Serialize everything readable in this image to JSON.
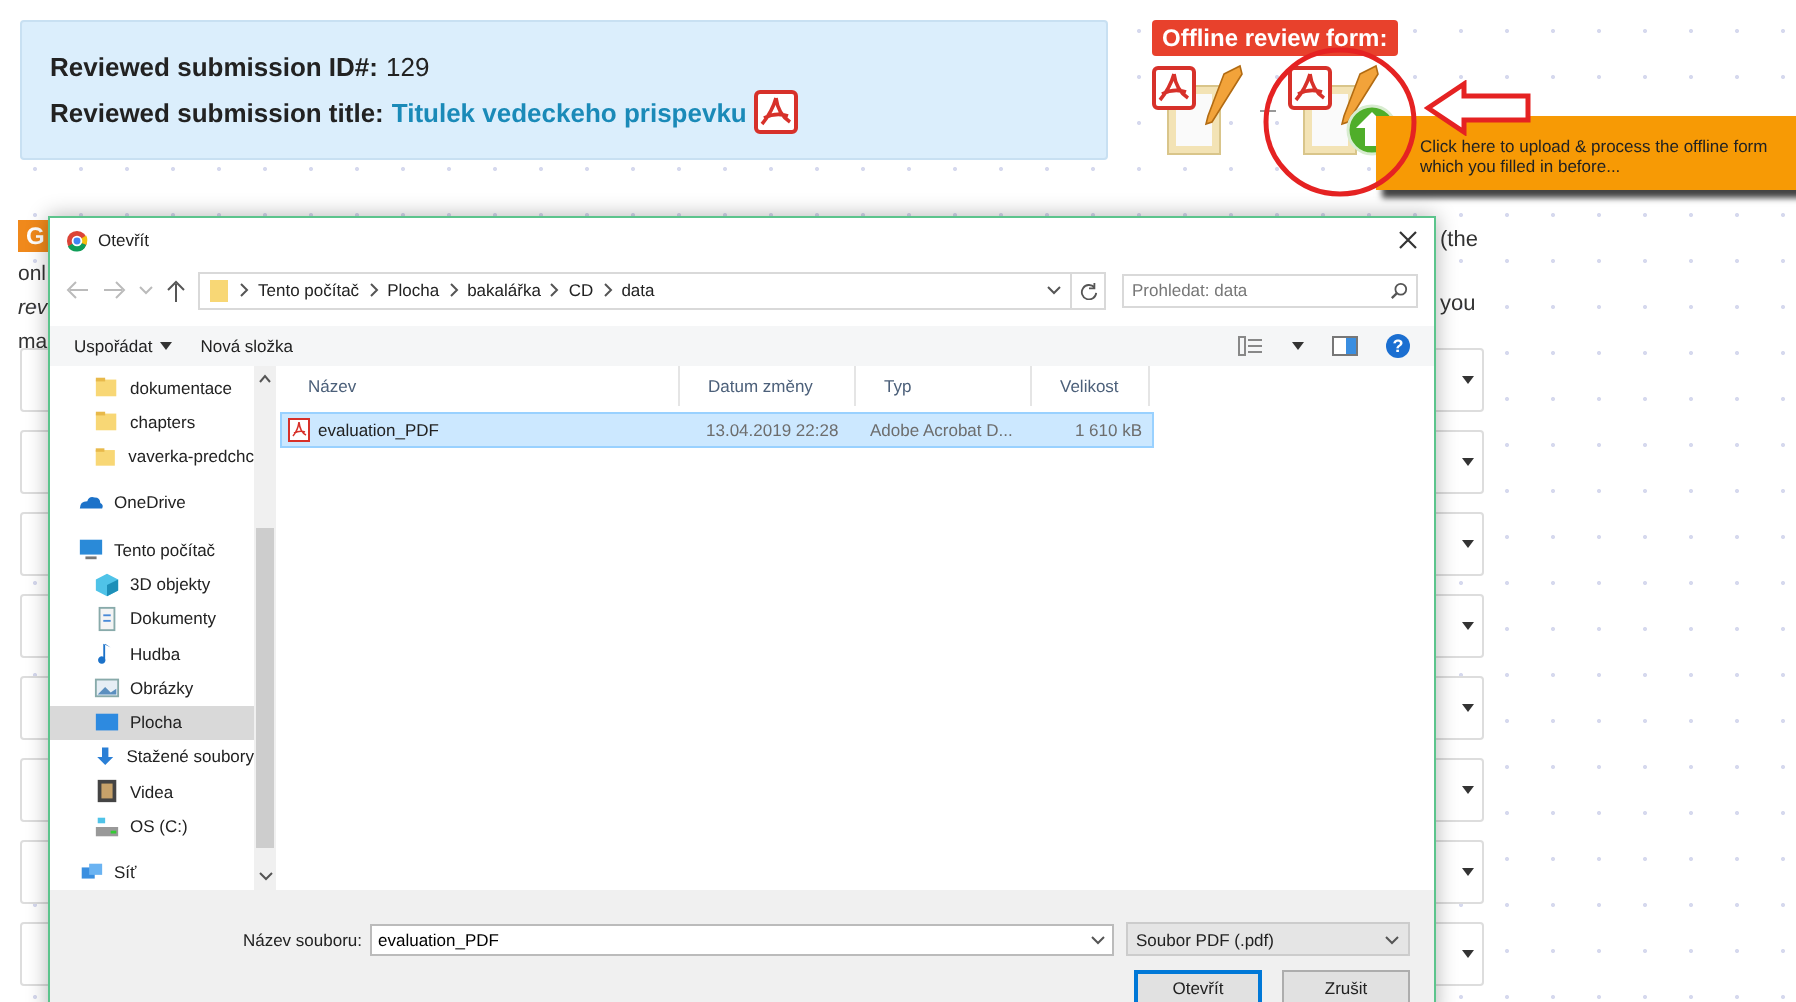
{
  "submission": {
    "id_label": "Reviewed submission ID#:",
    "id_value": "129",
    "title_label": "Reviewed submission title:",
    "title_link": "Titulek vedeckeho prispevku"
  },
  "offline_form": {
    "label": "Offline review form:",
    "tooltip": "Click here to upload & process the offline form which you filled in before..."
  },
  "page_text": {
    "badge": "G",
    "left_lines": [
      "onl",
      "rev",
      "ma"
    ],
    "right_lines": [
      "(the",
      "you"
    ]
  },
  "form_selects": [
    {
      "kind": "dropdown"
    },
    {
      "kind": "dropdown"
    },
    {
      "kind": "dropdown"
    },
    {
      "kind": "dropdown"
    },
    {
      "kind": "dropdown"
    },
    {
      "kind": "dropdown"
    },
    {
      "kind": "dropdown"
    },
    {
      "kind": "dropdown"
    }
  ],
  "dialog": {
    "title": "Otevřít",
    "breadcrumb": [
      "Tento počítač",
      "Plocha",
      "bakalářka",
      "CD",
      "data"
    ],
    "search": {
      "placeholder": "Prohledat: data"
    },
    "toolbar": {
      "organize": "Uspořádat",
      "new_folder": "Nová složka",
      "help": "?"
    },
    "nav": [
      {
        "children": [
          {
            "label": "dokumentace",
            "selected": false
          },
          {
            "label": "chapters",
            "selected": false
          },
          {
            "label": "vaverka-predchc",
            "selected": false
          }
        ]
      },
      {
        "label": "OneDrive",
        "selected": false
      },
      {
        "label": "Tento počítač",
        "selected": false,
        "children": [
          {
            "label": "3D objekty",
            "selected": false
          },
          {
            "label": "Dokumenty",
            "selected": false
          },
          {
            "label": "Hudba",
            "selected": false
          },
          {
            "label": "Obrázky",
            "selected": false
          },
          {
            "label": "Plocha",
            "selected": true
          },
          {
            "label": "Stažené soubory",
            "selected": false
          },
          {
            "label": "Videa",
            "selected": false
          },
          {
            "label": "OS (C:)",
            "selected": false
          }
        ]
      },
      {
        "label": "Síť",
        "selected": false
      }
    ],
    "columns": [
      "Název",
      "Datum změny",
      "Typ",
      "Velikost"
    ],
    "files": [
      {
        "name": "evaluation_PDF",
        "date": "13.04.2019 22:28",
        "type": "Adobe Acrobat D...",
        "size": "1 610 kB",
        "selected": true
      }
    ],
    "filename_label": "Název souboru:",
    "filename_value": "evaluation_PDF",
    "filter": "Soubor PDF (.pdf)",
    "buttons": [
      {
        "label": "Otevřít",
        "kind": "default"
      },
      {
        "label": "Zrušit",
        "kind": "normal"
      }
    ]
  }
}
